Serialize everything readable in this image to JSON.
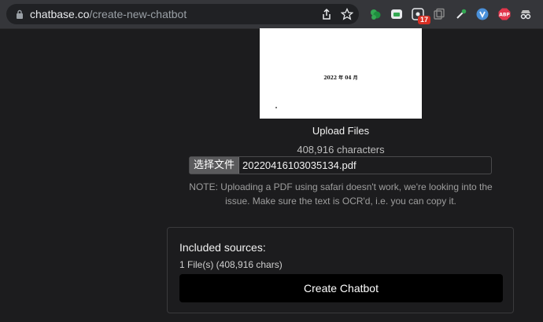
{
  "browser": {
    "url_host": "chatbase.co",
    "url_path": "/create-new-chatbot",
    "extension_badge": "17"
  },
  "upload": {
    "preview_text": "2022 年 04 月",
    "title": "Upload Files",
    "char_count": "408,916 characters",
    "choose_file_label": "选择文件",
    "file_name": "20220416103035134.pdf",
    "note": "NOTE: Uploading a PDF using safari doesn't work, we're looking into the issue. Make sure the text is OCR'd, i.e. you can copy it."
  },
  "sources": {
    "title": "Included sources:",
    "summary": "1 File(s) (408,916 chars)",
    "create_button_label": "Create Chatbot"
  }
}
